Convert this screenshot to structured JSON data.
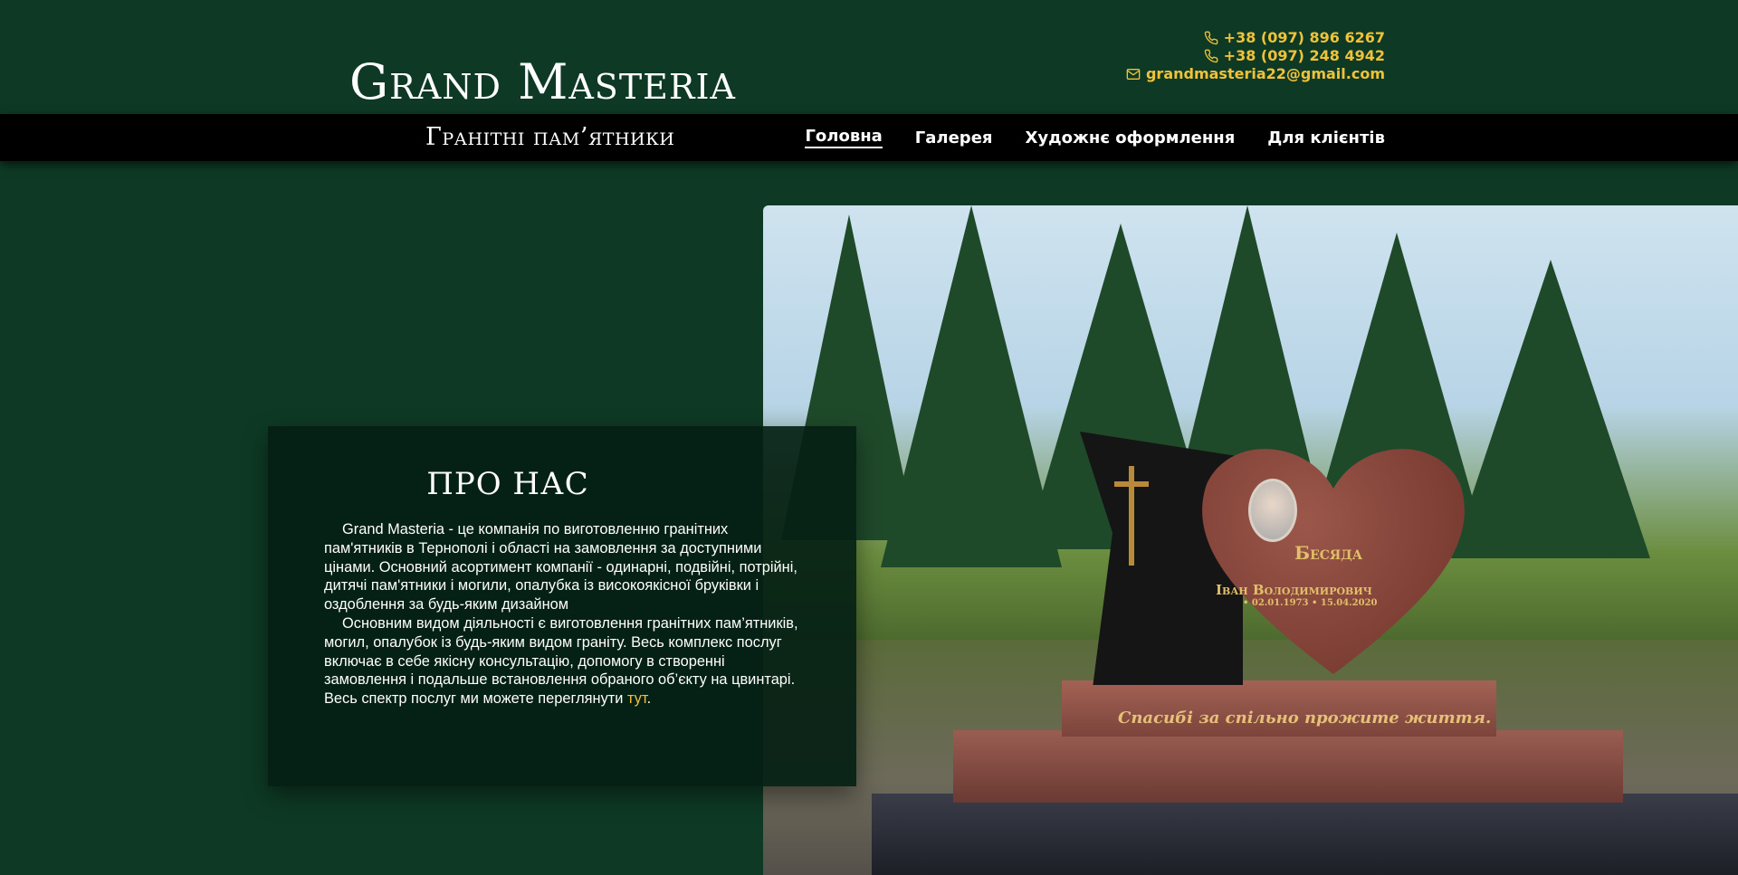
{
  "header": {
    "brand": "Grand Masteria",
    "tagline": "Гранітні пам’ятники",
    "contacts": [
      {
        "icon": "phone-icon",
        "text": "+38 (097) 896 6267"
      },
      {
        "icon": "phone-icon",
        "text": "+38 (097) 248 4942"
      },
      {
        "icon": "mail-icon",
        "text": "grandmasteria22@gmail.com"
      }
    ]
  },
  "nav": {
    "items": [
      {
        "label": "Головна",
        "active": true
      },
      {
        "label": "Галерея"
      },
      {
        "label": "Художнє оформлення"
      },
      {
        "label": "Для клієнтів"
      }
    ]
  },
  "about": {
    "title": "ПРО НАС",
    "p1": "Grand Masteria - це компанія по виготовленню гранітних пам'ятників в Тернополі і області на замовлення за доступними цінами. Основний асортимент компанії - одинарні, подвійні, потрійні, дитячі пам'ятники і могили, опалубка із високоякісної бруківки і оздоблення за будь-яким дизайном",
    "p2_text": "Основним видом діяльності є виготовлення гранітних пам’ятників, могил, опалубок із будь-яким видом граніту. Весь комплекс послуг включає в себе якісну консультацію, допомогу в створенні замовлення і подальше встановлення обраного об’єкту на цвинтарі. Весь спектр послуг ми можете переглянути ",
    "p2_link": "тут",
    "p2_end": "."
  },
  "hero": {
    "monument_name": "Бесяда",
    "monument_firstname": "Іван Володимирович",
    "monument_dates": "• 02.01.1973 • 15.04.2020",
    "epitaph": "Спасибі за спільно прожите життя."
  },
  "colors": {
    "background": "#0e3a25",
    "accent": "#f0c23a",
    "nav_bg": "#000000"
  }
}
